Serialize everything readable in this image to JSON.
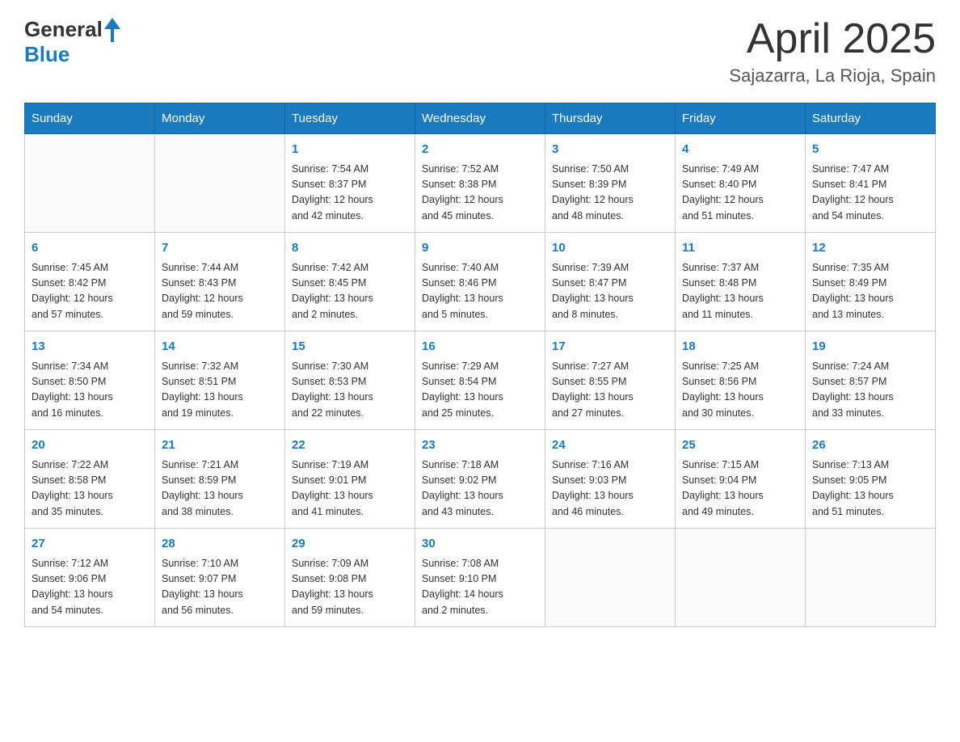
{
  "header": {
    "logo_text_main": "General",
    "logo_text_blue": "Blue",
    "month_title": "April 2025",
    "subtitle": "Sajazarra, La Rioja, Spain"
  },
  "weekdays": [
    "Sunday",
    "Monday",
    "Tuesday",
    "Wednesday",
    "Thursday",
    "Friday",
    "Saturday"
  ],
  "weeks": [
    [
      {
        "day": "",
        "info": ""
      },
      {
        "day": "",
        "info": ""
      },
      {
        "day": "1",
        "info": "Sunrise: 7:54 AM\nSunset: 8:37 PM\nDaylight: 12 hours\nand 42 minutes."
      },
      {
        "day": "2",
        "info": "Sunrise: 7:52 AM\nSunset: 8:38 PM\nDaylight: 12 hours\nand 45 minutes."
      },
      {
        "day": "3",
        "info": "Sunrise: 7:50 AM\nSunset: 8:39 PM\nDaylight: 12 hours\nand 48 minutes."
      },
      {
        "day": "4",
        "info": "Sunrise: 7:49 AM\nSunset: 8:40 PM\nDaylight: 12 hours\nand 51 minutes."
      },
      {
        "day": "5",
        "info": "Sunrise: 7:47 AM\nSunset: 8:41 PM\nDaylight: 12 hours\nand 54 minutes."
      }
    ],
    [
      {
        "day": "6",
        "info": "Sunrise: 7:45 AM\nSunset: 8:42 PM\nDaylight: 12 hours\nand 57 minutes."
      },
      {
        "day": "7",
        "info": "Sunrise: 7:44 AM\nSunset: 8:43 PM\nDaylight: 12 hours\nand 59 minutes."
      },
      {
        "day": "8",
        "info": "Sunrise: 7:42 AM\nSunset: 8:45 PM\nDaylight: 13 hours\nand 2 minutes."
      },
      {
        "day": "9",
        "info": "Sunrise: 7:40 AM\nSunset: 8:46 PM\nDaylight: 13 hours\nand 5 minutes."
      },
      {
        "day": "10",
        "info": "Sunrise: 7:39 AM\nSunset: 8:47 PM\nDaylight: 13 hours\nand 8 minutes."
      },
      {
        "day": "11",
        "info": "Sunrise: 7:37 AM\nSunset: 8:48 PM\nDaylight: 13 hours\nand 11 minutes."
      },
      {
        "day": "12",
        "info": "Sunrise: 7:35 AM\nSunset: 8:49 PM\nDaylight: 13 hours\nand 13 minutes."
      }
    ],
    [
      {
        "day": "13",
        "info": "Sunrise: 7:34 AM\nSunset: 8:50 PM\nDaylight: 13 hours\nand 16 minutes."
      },
      {
        "day": "14",
        "info": "Sunrise: 7:32 AM\nSunset: 8:51 PM\nDaylight: 13 hours\nand 19 minutes."
      },
      {
        "day": "15",
        "info": "Sunrise: 7:30 AM\nSunset: 8:53 PM\nDaylight: 13 hours\nand 22 minutes."
      },
      {
        "day": "16",
        "info": "Sunrise: 7:29 AM\nSunset: 8:54 PM\nDaylight: 13 hours\nand 25 minutes."
      },
      {
        "day": "17",
        "info": "Sunrise: 7:27 AM\nSunset: 8:55 PM\nDaylight: 13 hours\nand 27 minutes."
      },
      {
        "day": "18",
        "info": "Sunrise: 7:25 AM\nSunset: 8:56 PM\nDaylight: 13 hours\nand 30 minutes."
      },
      {
        "day": "19",
        "info": "Sunrise: 7:24 AM\nSunset: 8:57 PM\nDaylight: 13 hours\nand 33 minutes."
      }
    ],
    [
      {
        "day": "20",
        "info": "Sunrise: 7:22 AM\nSunset: 8:58 PM\nDaylight: 13 hours\nand 35 minutes."
      },
      {
        "day": "21",
        "info": "Sunrise: 7:21 AM\nSunset: 8:59 PM\nDaylight: 13 hours\nand 38 minutes."
      },
      {
        "day": "22",
        "info": "Sunrise: 7:19 AM\nSunset: 9:01 PM\nDaylight: 13 hours\nand 41 minutes."
      },
      {
        "day": "23",
        "info": "Sunrise: 7:18 AM\nSunset: 9:02 PM\nDaylight: 13 hours\nand 43 minutes."
      },
      {
        "day": "24",
        "info": "Sunrise: 7:16 AM\nSunset: 9:03 PM\nDaylight: 13 hours\nand 46 minutes."
      },
      {
        "day": "25",
        "info": "Sunrise: 7:15 AM\nSunset: 9:04 PM\nDaylight: 13 hours\nand 49 minutes."
      },
      {
        "day": "26",
        "info": "Sunrise: 7:13 AM\nSunset: 9:05 PM\nDaylight: 13 hours\nand 51 minutes."
      }
    ],
    [
      {
        "day": "27",
        "info": "Sunrise: 7:12 AM\nSunset: 9:06 PM\nDaylight: 13 hours\nand 54 minutes."
      },
      {
        "day": "28",
        "info": "Sunrise: 7:10 AM\nSunset: 9:07 PM\nDaylight: 13 hours\nand 56 minutes."
      },
      {
        "day": "29",
        "info": "Sunrise: 7:09 AM\nSunset: 9:08 PM\nDaylight: 13 hours\nand 59 minutes."
      },
      {
        "day": "30",
        "info": "Sunrise: 7:08 AM\nSunset: 9:10 PM\nDaylight: 14 hours\nand 2 minutes."
      },
      {
        "day": "",
        "info": ""
      },
      {
        "day": "",
        "info": ""
      },
      {
        "day": "",
        "info": ""
      }
    ]
  ]
}
